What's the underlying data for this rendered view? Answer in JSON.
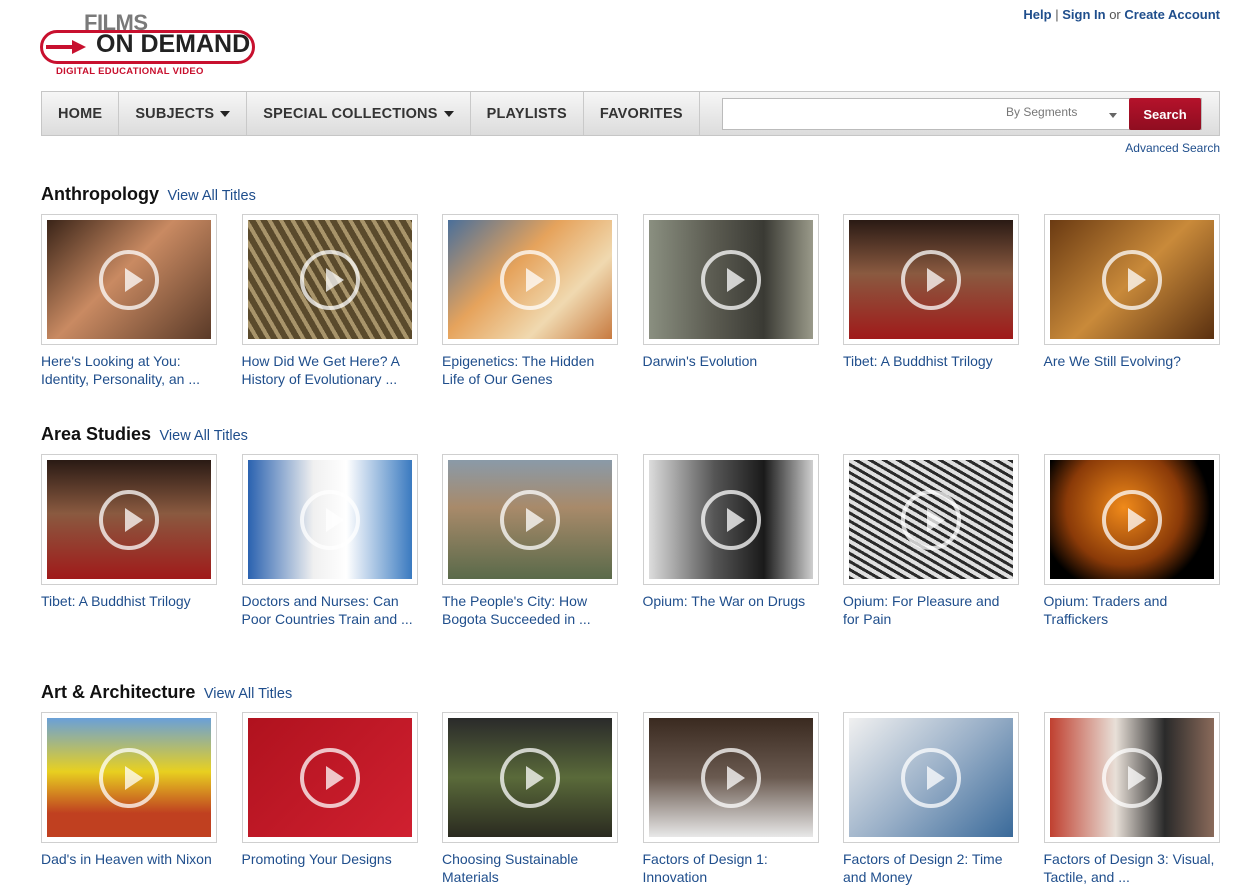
{
  "brand": {
    "films": "FILMS",
    "on_demand": "ON DEMAND",
    "tagline": "DIGITAL EDUCATIONAL VIDEO",
    "color": "#c8102e"
  },
  "toplinks": {
    "help": "Help",
    "divider": "|",
    "sign_in": "Sign In",
    "or": "or",
    "create_account": "Create Account"
  },
  "nav": {
    "home": "HOME",
    "subjects": "SUBJECTS",
    "special_collections": "SPECIAL COLLECTIONS",
    "playlists": "PLAYLISTS",
    "favorites": "FAVORITES"
  },
  "search": {
    "value": "",
    "scope": "By Segments",
    "button": "Search",
    "advanced": "Advanced Search"
  },
  "sections": [
    {
      "title": "Anthropology",
      "view_all": "View All Titles",
      "items": [
        {
          "title": "Here's Looking at You: Identity, Personality, an ...",
          "bg": "linear-gradient(135deg,#3a2418,#c98a62 45%,#5a3a28)"
        },
        {
          "title": "How Did We Get Here? A History of Evolutionary ...",
          "bg": "repeating-linear-gradient(60deg,#5a4a2c 0 6px,#a8946a 6px 10px)"
        },
        {
          "title": "Epigenetics: The Hidden Life of Our Genes",
          "bg": "linear-gradient(135deg,#4a6f9a,#e6a35c 40%,#f0d9b0 70%,#c77a40)"
        },
        {
          "title": "Darwin's Evolution",
          "bg": "linear-gradient(90deg,#8a8f80,#5a5a50 40%,#3a3a34 70%,#9a9a8a)"
        },
        {
          "title": "Tibet: A Buddhist Trilogy",
          "bg": "linear-gradient(180deg,#2a1a14,#8a5a40 45%,#a01a1a)"
        },
        {
          "title": "Are We Still Evolving?",
          "bg": "linear-gradient(135deg,#6a3a12,#c98a3a 50%,#5a3010)"
        }
      ]
    },
    {
      "title": "Area Studies",
      "view_all": "View All Titles",
      "items": [
        {
          "title": "Tibet: A Buddhist Trilogy",
          "bg": "linear-gradient(180deg,#2a1a14,#8a5a40 45%,#a01a1a)"
        },
        {
          "title": "Doctors and Nurses: Can Poor Countries Train and ...",
          "bg": "linear-gradient(90deg,#2a62b0,#f0f0f0 40%,#ffffff 60%,#3a7ac0)"
        },
        {
          "title": "The People's City: How Bogota Succeeded in ...",
          "bg": "linear-gradient(180deg,#8a9aa8,#a88a6a 40%,#5a6a4a)"
        },
        {
          "title": "Opium: The War on Drugs",
          "bg": "linear-gradient(90deg,#dcdcdc,#555 40%,#1a1a1a 70%,#cfcfcf)"
        },
        {
          "title": "Opium: For Pleasure and for Pain",
          "bg": "repeating-linear-gradient(30deg,#2a2a2a 0 3px,#e0e0e0 3px 7px)"
        },
        {
          "title": "Opium: Traders and Traffickers",
          "bg": "radial-gradient(circle at 45% 40%,#f08a1a,#8a3a08 50%,#000 75%)"
        }
      ]
    },
    {
      "title": "Art & Architecture",
      "view_all": "View All Titles",
      "items": [
        {
          "title": "Dad's in Heaven with Nixon",
          "bg": "linear-gradient(180deg,#6aa0d8,#e8d020 45%,#c04020 80%)"
        },
        {
          "title": "Promoting Your Designs",
          "bg": "linear-gradient(135deg,#b0121e,#d02030)"
        },
        {
          "title": "Choosing Sustainable Materials",
          "bg": "linear-gradient(180deg,#2a2a2a,#5a6a3a 50%,#2a2a20)"
        },
        {
          "title": "Factors of Design 1: Innovation",
          "bg": "linear-gradient(180deg,#3a2a20,#6a5a50 50%,#e8e8e8)"
        },
        {
          "title": "Factors of Design 2: Time and Money",
          "bg": "linear-gradient(135deg,#f0f0f0,#9ab0c8 50%,#3a6a9a)"
        },
        {
          "title": "Factors of Design 3: Visual, Tactile, and ...",
          "bg": "linear-gradient(90deg,#c04030,#e8e0d8 40%,#2a2a2a 70%,#8a6a5a)"
        }
      ]
    }
  ]
}
